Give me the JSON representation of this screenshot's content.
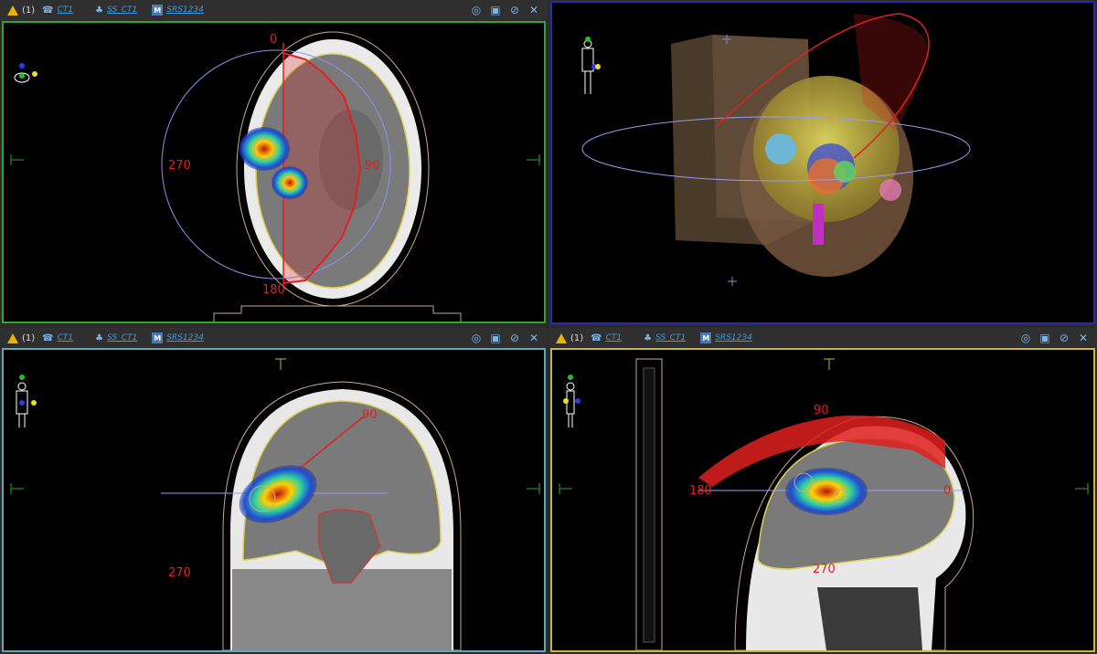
{
  "toolbars": {
    "warning_count": "(1)",
    "image_label": "CT1",
    "structure_set_label": "SS_CT1",
    "plan_label": "SRS1234",
    "plan_badge": "M"
  },
  "axial": {
    "angle_0": "0",
    "angle_90": "90",
    "angle_180": "180",
    "angle_270": "270"
  },
  "coronal": {
    "angle_90": "90",
    "angle_270": "270"
  },
  "sagittal": {
    "angle_0": "0",
    "angle_90": "90",
    "angle_180": "180",
    "angle_270": "270"
  },
  "colors": {
    "axial_border": "#2fa52f",
    "three_d_border": "#2a2aa8",
    "coronal_border": "#5fa8b8",
    "sagittal_border": "#c9b53a",
    "arc_red": "#e02020",
    "link_blue": "#3b9de6"
  },
  "icons": [
    "warning-icon",
    "image-icon",
    "structure-set-icon",
    "plan-icon",
    "target-icon",
    "camera-icon",
    "ruler-icon",
    "close-icon",
    "patient-orientation-icon"
  ]
}
